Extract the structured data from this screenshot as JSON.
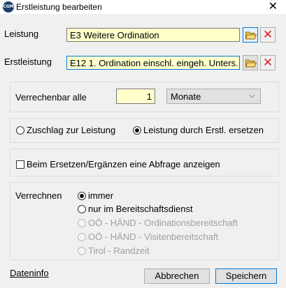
{
  "window": {
    "title": "Erstleistung bearbeiten",
    "icon_text": "CGM",
    "close_glyph": "✕"
  },
  "leistung": {
    "label": "Leistung",
    "value": "E3 Weitere Ordination"
  },
  "erstleistung": {
    "label": "Erstleistung",
    "value": "E12 1. Ordination einschl. eingeh. Unters."
  },
  "delete_glyph": "✕",
  "verrechenbar": {
    "label": "Verrechenbar alle",
    "value": "1",
    "unit_selected": "Monate",
    "chevron": "⌵"
  },
  "zuschlag_group": {
    "options": [
      {
        "label": "Zuschlag zur Leistung",
        "checked": false
      },
      {
        "label": "Leistung durch Erstl. ersetzen",
        "checked": true
      }
    ]
  },
  "abfrage": {
    "label": "Beim Ersetzen/Ergänzen eine Abfrage anzeigen",
    "checked": false
  },
  "verrechnen": {
    "label": "Verrechnen",
    "options": [
      {
        "label": "immer",
        "checked": true,
        "enabled": true
      },
      {
        "label": "nur im Bereitschaftsdienst",
        "checked": false,
        "enabled": true
      },
      {
        "label": "OÖ - HÄND - Ordinationsbereitschaft",
        "checked": false,
        "enabled": false
      },
      {
        "label": "OÖ - HÄND - Visitenbereitschaft",
        "checked": false,
        "enabled": false
      },
      {
        "label": "Tirol - Randzeit",
        "checked": false,
        "enabled": false
      }
    ]
  },
  "footer": {
    "dateninfo": "Dateninfo",
    "cancel": "Abbrechen",
    "save": "Speichern"
  }
}
